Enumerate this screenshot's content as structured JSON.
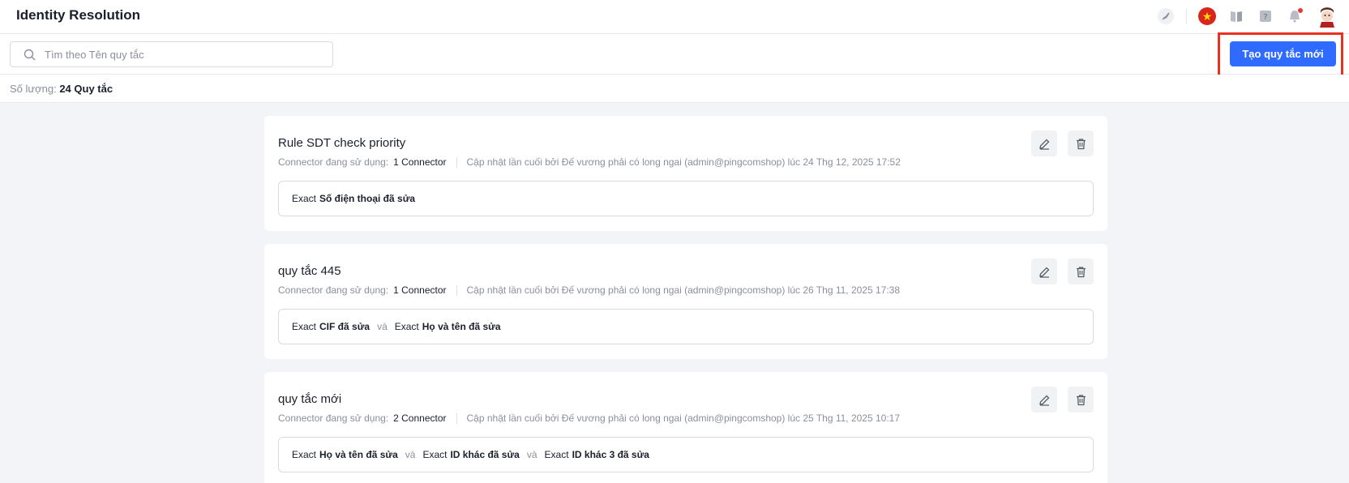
{
  "app": {
    "title": "Identity Resolution"
  },
  "topbar": {
    "icons": [
      "rocket-icon",
      "vietnam-flag-icon",
      "book-icon",
      "help-icon",
      "bell-icon",
      "user-avatar"
    ]
  },
  "search": {
    "placeholder": "Tìm theo Tên quy tắc",
    "value": ""
  },
  "create_button": {
    "label": "Tạo quy tắc mới"
  },
  "count": {
    "label": "Số lượng:",
    "value": "24 Quy tắc"
  },
  "colors": {
    "accent": "#2f6bff",
    "highlight": "#e8321f",
    "page_bg": "#f3f4f7"
  },
  "rules": [
    {
      "title": "Rule SDT check priority",
      "connector_label": "Connector đang sử dụng:",
      "connector_value": "1 Connector",
      "updated": "Cập nhật lần cuối bởi Đế vương phải có long ngai (admin@pingcomshop) lúc 24 Thg 12, 2025 17:52",
      "conditions": [
        {
          "exact": "Exact",
          "field": "Số điện thoại đã sửa"
        }
      ]
    },
    {
      "title": "quy tắc 445",
      "connector_label": "Connector đang sử dụng:",
      "connector_value": "1 Connector",
      "updated": "Cập nhật lần cuối bởi Đế vương phải có long ngai (admin@pingcomshop) lúc 26 Thg 11, 2025 17:38",
      "conditions": [
        {
          "exact": "Exact",
          "field": "CIF đã sửa"
        },
        {
          "exact": "Exact",
          "field": "Họ và tên đã sửa"
        }
      ]
    },
    {
      "title": "quy tắc mới",
      "connector_label": "Connector đang sử dụng:",
      "connector_value": "2 Connector",
      "updated": "Cập nhật lần cuối bởi Đế vương phải có long ngai (admin@pingcomshop) lúc 25 Thg 11, 2025 10:17",
      "conditions": [
        {
          "exact": "Exact",
          "field": "Họ và tên đã sửa"
        },
        {
          "exact": "Exact",
          "field": "ID khác đã sửa"
        },
        {
          "exact": "Exact",
          "field": "ID khác 3 đã sửa"
        }
      ]
    }
  ],
  "join_word": "và"
}
